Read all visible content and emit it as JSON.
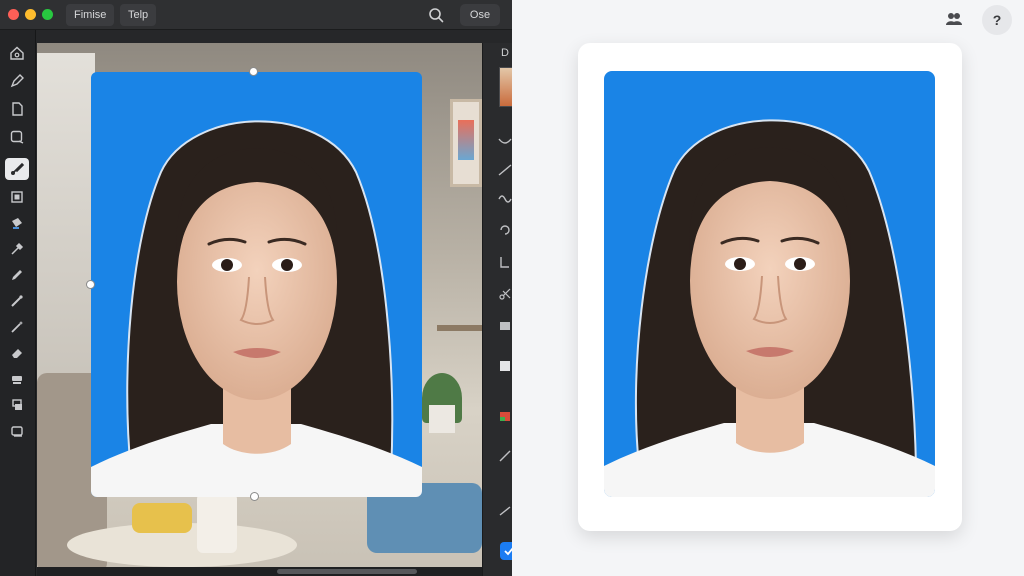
{
  "editor": {
    "menu": {
      "primary_label": "Fimise",
      "secondary_label": "Telp",
      "close_label": "Ose"
    },
    "panel": {
      "label": "D"
    },
    "tools": [
      {
        "name": "home-icon"
      },
      {
        "name": "pen-icon"
      },
      {
        "name": "document-icon"
      },
      {
        "name": "frame-icon"
      },
      {
        "name": "brush-icon",
        "active": true
      },
      {
        "name": "grid-icon"
      },
      {
        "name": "fill-icon"
      },
      {
        "name": "eyedropper-icon"
      },
      {
        "name": "pencil-icon"
      },
      {
        "name": "smudge-icon"
      },
      {
        "name": "wand-icon"
      },
      {
        "name": "eraser-icon"
      },
      {
        "name": "stamp-icon"
      },
      {
        "name": "layers-icon"
      },
      {
        "name": "crop-icon"
      }
    ],
    "photo_background": "#1a84e6"
  },
  "preview": {
    "help_label": "?",
    "background": "#1a84e6"
  },
  "colors": {
    "accent": "#1b7cf2",
    "photo_blue": "#1a84e6",
    "dark_ui": "#262729"
  }
}
